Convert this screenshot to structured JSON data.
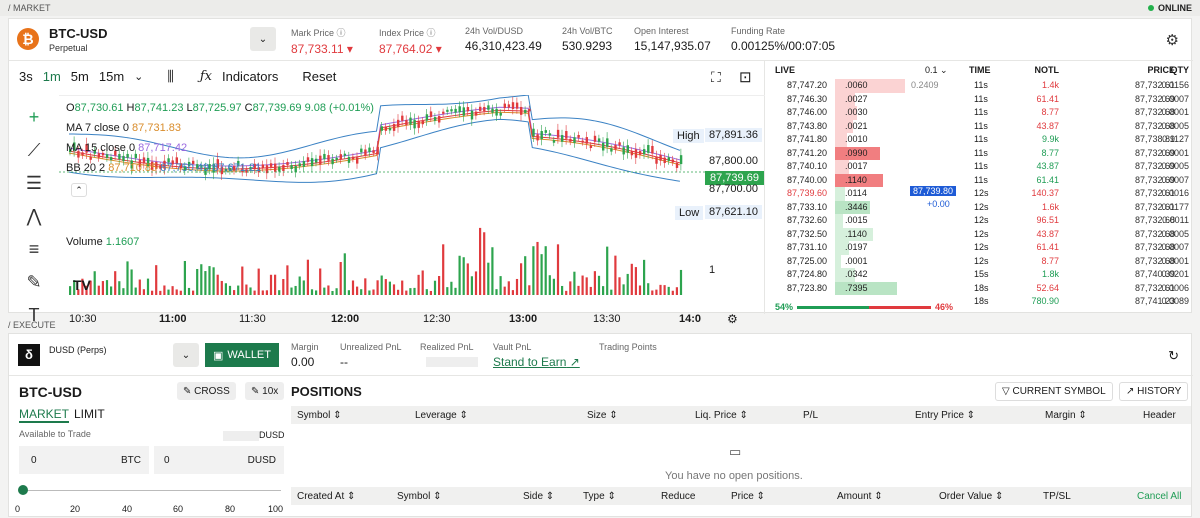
{
  "strip": {
    "market": "/ MARKET",
    "online": "ONLINE",
    "execute": "/ EXECUTE"
  },
  "pair": {
    "symbol": "BTC-USD",
    "type": "Perpetual",
    "logo_color": "#e8731a"
  },
  "ticker": [
    {
      "label": "Mark Price",
      "value": "87,733.11",
      "red": true,
      "caret": true
    },
    {
      "label": "Index Price",
      "value": "87,764.02",
      "red": true,
      "caret": true
    },
    {
      "label": "24h Vol/DUSD",
      "value": "46,310,423.49"
    },
    {
      "label": "24h Vol/BTC",
      "value": "530.9293"
    },
    {
      "label": "Open Interest",
      "value": "15,147,935.07"
    },
    {
      "label": "Funding Rate",
      "value": "0.00125%/00:07:05"
    }
  ],
  "toolbar": {
    "tf": [
      "3s",
      "1m",
      "5m",
      "15m"
    ],
    "indicators": "Indicators",
    "reset": "Reset"
  },
  "ohlc": {
    "o": "87,730.61",
    "h": "87,741.23",
    "l": "87,725.97",
    "c": "87,739.69",
    "chg": "9.08 (+0.01%)"
  },
  "ma7": {
    "label": "MA 7 close 0",
    "value": "87,731.83"
  },
  "ma15": {
    "label": "MA 15 close 0",
    "value": "87,717.42"
  },
  "bb": {
    "label": "BB 20 2",
    "v1": "87,710.85",
    "v2": "87,750.49",
    "v3": "87,671.21"
  },
  "vol": {
    "label": "Volume",
    "value": "1.1607"
  },
  "axis": {
    "high_label": "High",
    "high": "87,891.36",
    "p1": "87,800.00",
    "cur": "87,739.69",
    "p2": "87,700.00",
    "low_label": "Low",
    "low": "87,621.10",
    "v1": "1"
  },
  "xticks": [
    "10:30",
    "11:00",
    "11:30",
    "12:00",
    "12:30",
    "13:00",
    "13:30",
    "14:0"
  ],
  "orderbook": {
    "title": "LIVE",
    "step": "0.1",
    "ghost": "0.2409",
    "asks": [
      [
        "87,747.20",
        ".0060"
      ],
      [
        "87,746.30",
        ".0027"
      ],
      [
        "87,746.00",
        ".0030"
      ],
      [
        "87,743.80",
        ".0021"
      ],
      [
        "87,741.80",
        ".0010"
      ],
      [
        "87,741.20",
        ".0990"
      ],
      [
        "87,740.10",
        ".0017"
      ],
      [
        "87,740.00",
        ".1140"
      ]
    ],
    "bids": [
      [
        "87,739.60",
        ".0114"
      ],
      [
        "87,733.10",
        ".3446"
      ],
      [
        "87,732.60",
        ".0015"
      ],
      [
        "87,732.50",
        ".1140"
      ],
      [
        "87,731.10",
        ".0197"
      ],
      [
        "87,725.00",
        ".0001"
      ],
      [
        "87,724.80",
        ".0342"
      ],
      [
        "87,723.80",
        ".7395"
      ]
    ],
    "mid": "87,739.80",
    "mid_delta": "+0.00",
    "buy_pct": "54%",
    "sell_pct": "46%"
  },
  "trades": {
    "headers": [
      "TIME",
      "NOTL",
      "PRICE",
      "QTY"
    ],
    "rows": [
      [
        "11s",
        "1.4k",
        "87,732.61",
        "0.0156",
        "r"
      ],
      [
        "11s",
        "61.41",
        "87,732.69",
        "0.0007",
        "r"
      ],
      [
        "11s",
        "8.77",
        "87,732.68",
        "0.0001",
        "r"
      ],
      [
        "11s",
        "43.87",
        "87,732.68",
        "0.0005",
        "r"
      ],
      [
        "11s",
        "9.9k",
        "87,738.89",
        "0.1127",
        "g"
      ],
      [
        "11s",
        "8.77",
        "87,732.69",
        "0.0001",
        "g"
      ],
      [
        "11s",
        "43.87",
        "87,732.69",
        "0.0005",
        "g"
      ],
      [
        "11s",
        "61.41",
        "87,732.69",
        "0.0007",
        "g"
      ],
      [
        "12s",
        "140.37",
        "87,732.61",
        "0.0016",
        "r"
      ],
      [
        "12s",
        "1.6k",
        "87,732.61",
        "0.0177",
        "r"
      ],
      [
        "12s",
        "96.51",
        "87,732.68",
        "0.0011",
        "r"
      ],
      [
        "12s",
        "43.87",
        "87,732.68",
        "0.0005",
        "r"
      ],
      [
        "12s",
        "61.41",
        "87,732.68",
        "0.0007",
        "r"
      ],
      [
        "12s",
        "8.77",
        "87,732.68",
        "0.0001",
        "r"
      ],
      [
        "15s",
        "1.8k",
        "87,740.39",
        "0.0201",
        "g"
      ],
      [
        "18s",
        "52.64",
        "87,732.61",
        "0.0006",
        "r"
      ],
      [
        "18s",
        "780.90",
        "87,741.23",
        "0.0089",
        "g"
      ]
    ]
  },
  "account": {
    "token": "DUSD (Perps)",
    "wallet": "WALLET",
    "margin_l": "Margin",
    "margin": "0.00",
    "upnl_l": "Unrealized PnL",
    "upnl": "--",
    "rpnl_l": "Realized PnL",
    "vault_l": "Vault PnL",
    "stand": "Stand to Earn",
    "tp_l": "Trading Points"
  },
  "order": {
    "pair": "BTC-USD",
    "cross": "CROSS",
    "lev": "10x",
    "market": "MARKET",
    "limit": "LIMIT",
    "avail": "Available to Trade",
    "avail_unit": "DUSD",
    "q1": "0",
    "u1": "BTC",
    "q2": "0",
    "u2": "DUSD",
    "slider": [
      "0",
      "20",
      "40",
      "60",
      "80",
      "100"
    ]
  },
  "positions": {
    "title": "POSITIONS",
    "cur": "CURRENT SYMBOL",
    "hist": "HISTORY",
    "cols": [
      "Symbol",
      "Leverage",
      "Size",
      "Liq. Price",
      "P/L",
      "Entry Price",
      "Margin",
      "Header"
    ],
    "empty": "You have no open positions.",
    "cols2": [
      "Created At",
      "Symbol",
      "Side",
      "Type",
      "Reduce",
      "Price",
      "Amount",
      "Order Value",
      "TP/SL"
    ],
    "cancel": "Cancel All"
  }
}
